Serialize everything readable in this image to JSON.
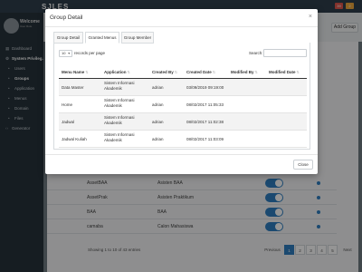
{
  "app": {
    "brand": "SJLES",
    "header_badges": [
      {
        "label": "39",
        "color": "#e2574c"
      },
      {
        "label": "2",
        "color": "#f0a73c"
      }
    ],
    "profile": {
      "name": "Welcome",
      "subtitle": "User Role"
    },
    "sidebar": {
      "items": [
        {
          "label": "Dashboard",
          "icon": "dashboard-icon",
          "indent": false,
          "active": false
        },
        {
          "label": "System Privileg...",
          "icon": "settings-icon",
          "indent": false,
          "active": true
        },
        {
          "label": "Users",
          "icon": "bullet-icon",
          "indent": true,
          "active": false
        },
        {
          "label": "Groups",
          "icon": "bullet-icon",
          "indent": true,
          "active": true
        },
        {
          "label": "Application",
          "icon": "bullet-icon",
          "indent": true,
          "active": false
        },
        {
          "label": "Menus",
          "icon": "bullet-icon",
          "indent": true,
          "active": false
        },
        {
          "label": "Domain",
          "icon": "bullet-icon",
          "indent": true,
          "active": false
        },
        {
          "label": "Files",
          "icon": "bullet-icon",
          "indent": true,
          "active": false
        },
        {
          "label": "Generator",
          "icon": "code-icon",
          "indent": false,
          "active": false
        }
      ]
    },
    "add_group_label": "Add Group",
    "bg_table": {
      "rows": [
        {
          "col1": "AssetBAA",
          "col2": "Asisten BAA"
        },
        {
          "col1": "AssetPrak",
          "col2": "Asisten Praktikum"
        },
        {
          "col1": "BAA",
          "col2": "BAA"
        },
        {
          "col1": "camaba",
          "col2": "Calon Mahasiswa"
        }
      ],
      "info": "Showing 1 to 10 of 43 entries",
      "pagination": [
        "Previous",
        "1",
        "2",
        "3",
        "4",
        "5",
        "Next"
      ],
      "current_page": "1"
    },
    "colors": {
      "toggle_on": "#2f7fc1",
      "sidebar_bg": "#26323b"
    }
  },
  "modal": {
    "title": "Group Detail",
    "close_glyph": "×",
    "tabs": [
      {
        "label": "Group Detail",
        "active": false
      },
      {
        "label": "Granted Menus",
        "active": true
      },
      {
        "label": "Group Member",
        "active": false
      }
    ],
    "length_value": "10",
    "length_label": "records per page",
    "search_label": "Search:",
    "search_value": "",
    "columns": [
      "Menu Name",
      "Application",
      "Created By",
      "Created Date",
      "Modified By",
      "Modified Date"
    ],
    "rows": [
      {
        "menu": "Data Master",
        "app": [
          "Sistem Informasi",
          "Akademik"
        ],
        "created_by": "adrian",
        "created_date": "03/09/2019 09:19:00",
        "modified_by": "",
        "modified_date": ""
      },
      {
        "menu": "Home",
        "app": [
          "Sistem Informasi",
          "Akademik"
        ],
        "created_by": "adrian",
        "created_date": "08/02/2017 11:05:33",
        "modified_by": "",
        "modified_date": ""
      },
      {
        "menu": "Jadwal",
        "app": [
          "Sistem Informasi",
          "Akademik"
        ],
        "created_by": "adrian",
        "created_date": "08/02/2017 11:02:38",
        "modified_by": "",
        "modified_date": ""
      },
      {
        "menu": "Jadwal Kuliah",
        "app": [
          "Sistem Informasi",
          "Akademik"
        ],
        "created_by": "adrian",
        "created_date": "08/02/2017 11:03:09",
        "modified_by": "",
        "modified_date": ""
      }
    ],
    "footer_close_label": "Close"
  }
}
